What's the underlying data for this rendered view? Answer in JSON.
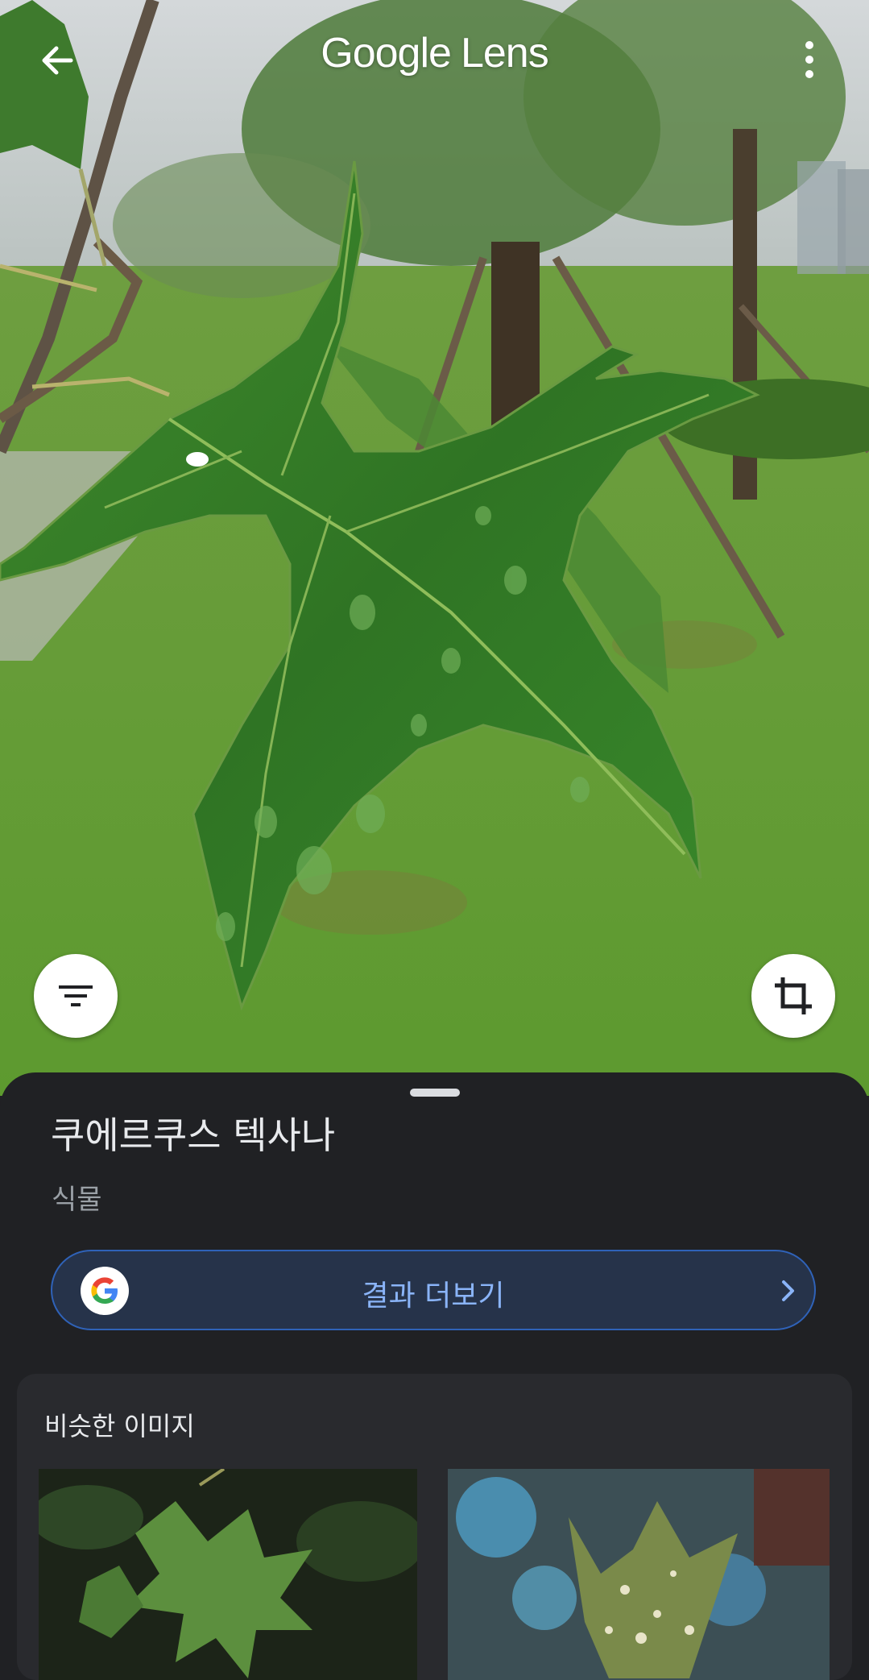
{
  "header": {
    "logo_google": "Google",
    "logo_lens": "Lens"
  },
  "result": {
    "title": "쿠에르쿠스 텍사나",
    "category": "식물",
    "more_results_label": "결과 더보기"
  },
  "similar_images": {
    "title": "비슷한 이미지"
  },
  "icons": {
    "back": "arrow-left-icon",
    "menu": "more-vert-icon",
    "filter": "filter-icon",
    "crop": "crop-icon",
    "google": "google-g-icon",
    "chevron": "chevron-right-icon"
  },
  "colors": {
    "sheet_bg": "#202124",
    "button_border": "#2f62b8",
    "button_text": "#8ab4f8",
    "button_bg": "#26334a"
  }
}
